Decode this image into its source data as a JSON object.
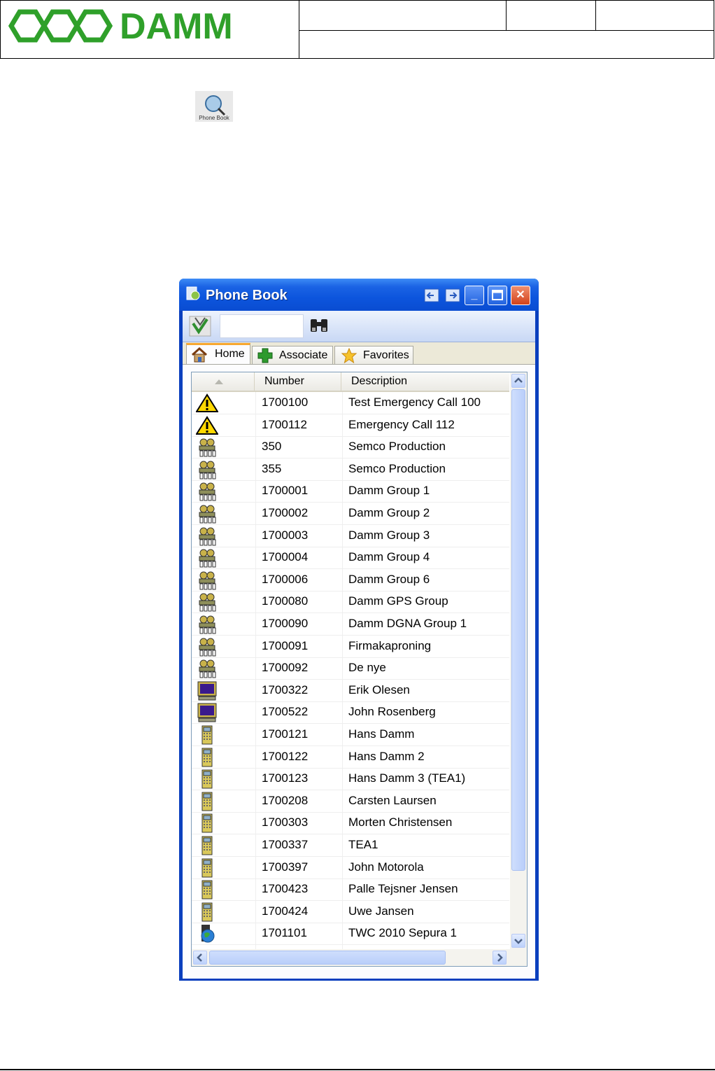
{
  "document": {
    "logo_text": "DAMM"
  },
  "small_icon_label": "Phone Book",
  "window": {
    "title": "Phone Book",
    "minimize": "_",
    "close": "✕"
  },
  "toolbar": {
    "search_value": ""
  },
  "tabs": [
    {
      "label": "Home"
    },
    {
      "label": "Associate"
    },
    {
      "label": "Favorites"
    }
  ],
  "columns": {
    "number": "Number",
    "description": "Description"
  },
  "rows": [
    {
      "icon": "warning-icon",
      "number": "1700100",
      "description": "Test Emergency Call 100"
    },
    {
      "icon": "warning-icon",
      "number": "1700112",
      "description": "Emergency Call 112"
    },
    {
      "icon": "group-icon",
      "number": "350",
      "description": "Semco Production"
    },
    {
      "icon": "group-icon",
      "number": "355",
      "description": "Semco Production"
    },
    {
      "icon": "group-icon",
      "number": "1700001",
      "description": "Damm Group 1"
    },
    {
      "icon": "group-icon",
      "number": "1700002",
      "description": "Damm Group 2"
    },
    {
      "icon": "group-icon",
      "number": "1700003",
      "description": "Damm Group 3"
    },
    {
      "icon": "group-icon",
      "number": "1700004",
      "description": "Damm Group 4"
    },
    {
      "icon": "group-icon",
      "number": "1700006",
      "description": "Damm Group 6"
    },
    {
      "icon": "group-icon",
      "number": "1700080",
      "description": "Damm GPS Group"
    },
    {
      "icon": "group-icon",
      "number": "1700090",
      "description": "Damm DGNA Group 1"
    },
    {
      "icon": "group-icon",
      "number": "1700091",
      "description": "Firmakaproning"
    },
    {
      "icon": "group-icon",
      "number": "1700092",
      "description": "De nye"
    },
    {
      "icon": "dispatcher-terminal-icon",
      "number": "1700322",
      "description": "Erik Olesen"
    },
    {
      "icon": "dispatcher-terminal-icon",
      "number": "1700522",
      "description": "John Rosenberg"
    },
    {
      "icon": "handheld-radio-icon",
      "number": "1700121",
      "description": "Hans Damm"
    },
    {
      "icon": "handheld-radio-icon",
      "number": "1700122",
      "description": "Hans Damm 2"
    },
    {
      "icon": "handheld-radio-icon",
      "number": "1700123",
      "description": "Hans Damm 3 (TEA1)"
    },
    {
      "icon": "handheld-radio-icon",
      "number": "1700208",
      "description": "Carsten Laursen"
    },
    {
      "icon": "handheld-radio-icon",
      "number": "1700303",
      "description": "Morten Christensen"
    },
    {
      "icon": "handheld-radio-icon",
      "number": "1700337",
      "description": "TEA1"
    },
    {
      "icon": "handheld-radio-icon",
      "number": "1700397",
      "description": "John Motorola"
    },
    {
      "icon": "handheld-radio-icon",
      "number": "1700423",
      "description": "Palle Tejsner Jensen"
    },
    {
      "icon": "handheld-radio-icon",
      "number": "1700424",
      "description": "Uwe Jansen"
    },
    {
      "icon": "globe-radio-icon",
      "number": "1701101",
      "description": "TWC 2010 Sepura 1"
    }
  ]
}
